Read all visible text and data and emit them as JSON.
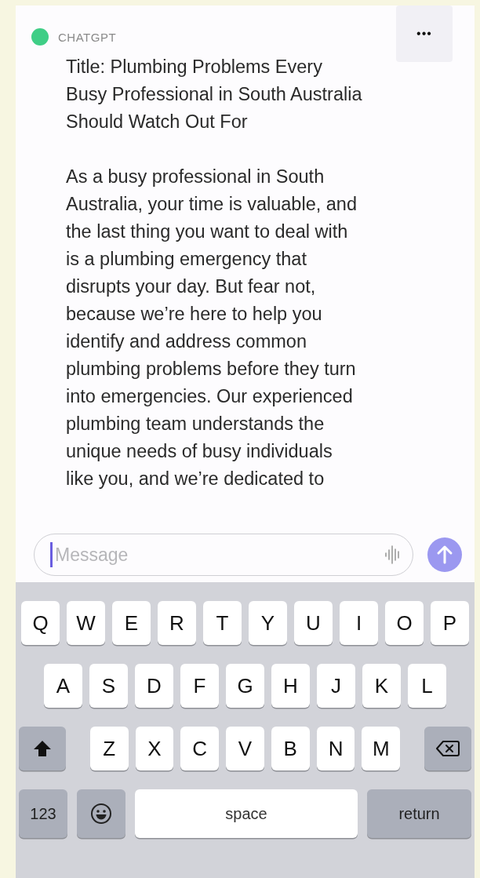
{
  "message": {
    "sender": "CHATGPT",
    "title_lines": [
      "Title: Plumbing Problems Every",
      "Busy Professional in South Australia",
      "Should Watch Out For"
    ],
    "body_lines": [
      "As a busy professional in South",
      "Australia, your time is valuable, and",
      "the last thing you want to deal with",
      "is a plumbing emergency that",
      "disrupts your day. But fear not,",
      "because we’re here to help you",
      "identify and address common",
      "plumbing problems before they turn",
      "into emergencies. Our experienced",
      "plumbing team understands the",
      "unique needs of busy individuals",
      "like you, and we’re dedicated to"
    ]
  },
  "more_button": {
    "label": "•••"
  },
  "composer": {
    "placeholder": "Message",
    "focused": true
  },
  "keyboard": {
    "rows": [
      {
        "keys": [
          {
            "kind": "letter",
            "label": "Q"
          },
          {
            "kind": "letter",
            "label": "W"
          },
          {
            "kind": "letter",
            "label": "E"
          },
          {
            "kind": "letter",
            "label": "R"
          },
          {
            "kind": "letter",
            "label": "T"
          },
          {
            "kind": "letter",
            "label": "Y"
          },
          {
            "kind": "letter",
            "label": "U"
          },
          {
            "kind": "letter",
            "label": "I"
          },
          {
            "kind": "letter",
            "label": "O"
          },
          {
            "kind": "letter",
            "label": "P"
          }
        ]
      },
      {
        "keys": [
          {
            "kind": "letter",
            "label": "A"
          },
          {
            "kind": "letter",
            "label": "S"
          },
          {
            "kind": "letter",
            "label": "D"
          },
          {
            "kind": "letter",
            "label": "F"
          },
          {
            "kind": "letter",
            "label": "G"
          },
          {
            "kind": "letter",
            "label": "H"
          },
          {
            "kind": "letter",
            "label": "J"
          },
          {
            "kind": "letter",
            "label": "K"
          },
          {
            "kind": "letter",
            "label": "L"
          }
        ]
      },
      {
        "keys": [
          {
            "kind": "shift"
          },
          {
            "kind": "letter",
            "label": "Z"
          },
          {
            "kind": "letter",
            "label": "X"
          },
          {
            "kind": "letter",
            "label": "C"
          },
          {
            "kind": "letter",
            "label": "V"
          },
          {
            "kind": "letter",
            "label": "B"
          },
          {
            "kind": "letter",
            "label": "N"
          },
          {
            "kind": "letter",
            "label": "M"
          },
          {
            "kind": "backspace"
          }
        ]
      },
      {
        "keys": [
          {
            "kind": "numbers",
            "label": "123"
          },
          {
            "kind": "emoji"
          },
          {
            "kind": "space",
            "label": "space"
          },
          {
            "kind": "return",
            "label": "return"
          }
        ]
      }
    ]
  }
}
